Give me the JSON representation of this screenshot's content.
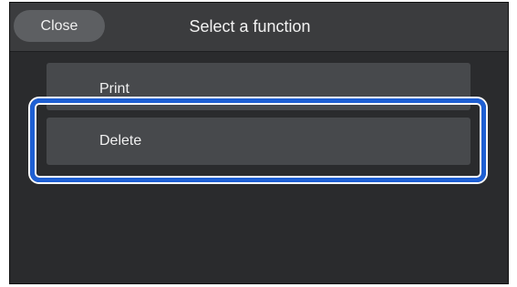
{
  "header": {
    "close_label": "Close",
    "title": "Select a function"
  },
  "menu": {
    "items": [
      {
        "label": "Print"
      },
      {
        "label": "Delete"
      }
    ],
    "selected_index": 1
  },
  "colors": {
    "highlight": "#1e5fd3",
    "screen_bg": "#2a2b2d",
    "header_bg": "#3b3c3e",
    "item_bg": "#47494c"
  }
}
